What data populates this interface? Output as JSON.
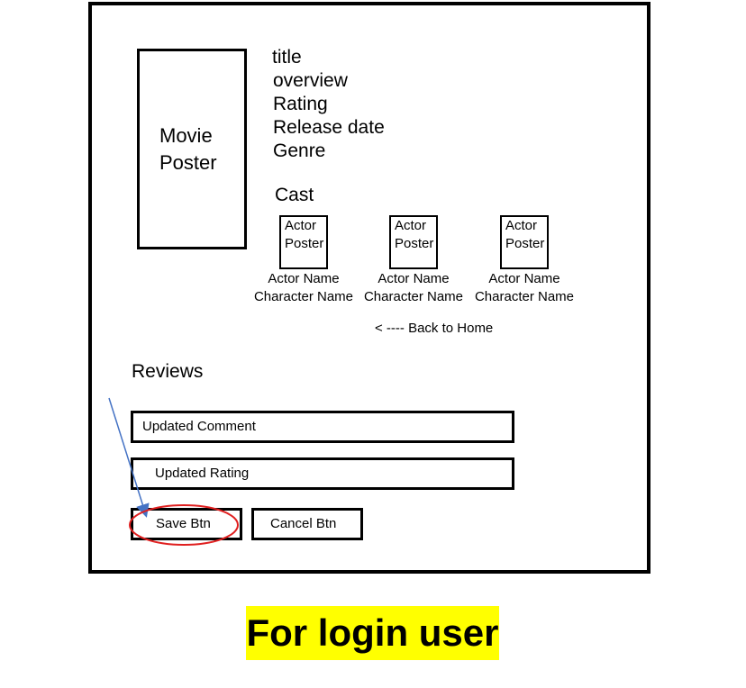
{
  "movie_poster": {
    "label_line1": "Movie",
    "label_line2": "Poster"
  },
  "details": {
    "title": "title",
    "overview": "overview",
    "rating": "Rating",
    "release_date": "Release date",
    "genre": "Genre"
  },
  "cast": {
    "heading": "Cast",
    "members": [
      {
        "poster_line1": "Actor",
        "poster_line2": "Poster",
        "actor_name": "Actor Name",
        "character_name": "Character Name"
      },
      {
        "poster_line1": "Actor",
        "poster_line2": "Poster",
        "actor_name": "Actor Name",
        "character_name": "Character Name"
      },
      {
        "poster_line1": "Actor",
        "poster_line2": "Poster",
        "actor_name": "Actor Name",
        "character_name": "Character Name"
      }
    ]
  },
  "back_link": "< ---- Back to Home",
  "reviews": {
    "heading": "Reviews",
    "comment_field": "Updated Comment",
    "rating_field": "Updated Rating",
    "save_button": "Save Btn",
    "cancel_button": "Cancel Btn"
  },
  "caption": "For login user",
  "colors": {
    "highlight": "#ffff00",
    "annotation_circle": "#e02020",
    "annotation_arrow": "#4472c4"
  }
}
